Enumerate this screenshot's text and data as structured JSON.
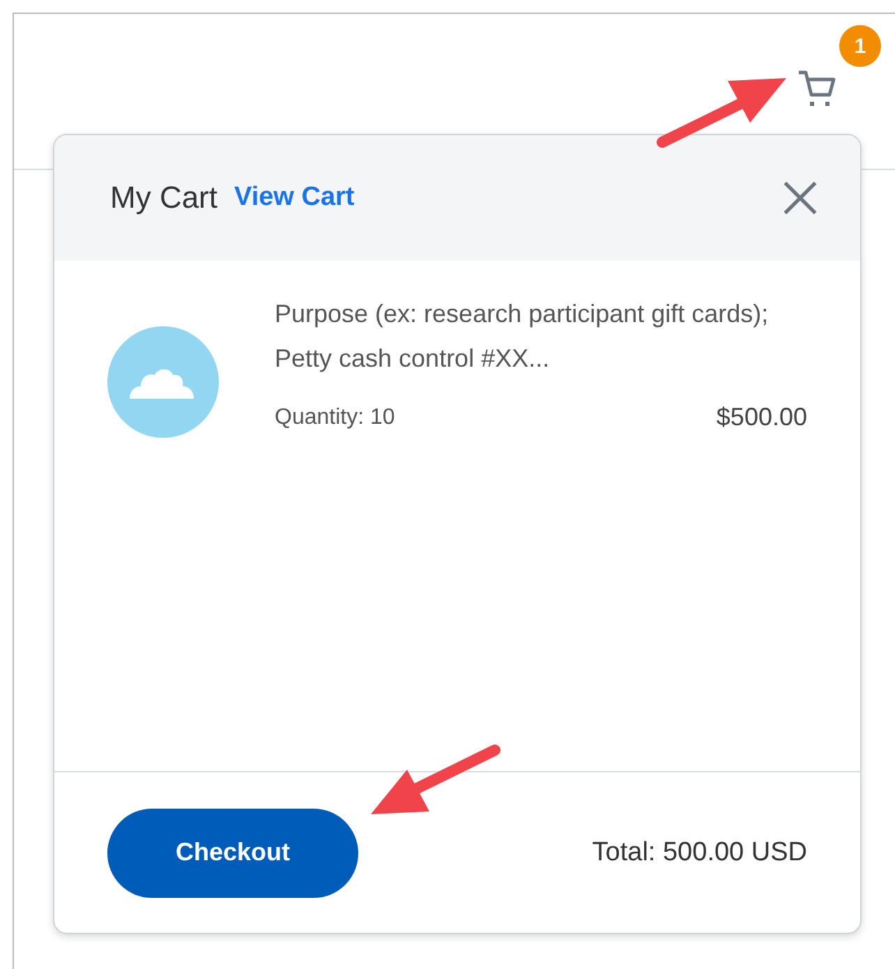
{
  "header": {
    "cart_badge": "1"
  },
  "cart_popup": {
    "title": "My Cart",
    "view_link": "View Cart",
    "items": [
      {
        "description": "Purpose (ex: research participant gift cards); Petty cash control #XX...",
        "quantity": "Quantity: 10",
        "price": "$500.00"
      }
    ],
    "checkout_button": "Checkout",
    "total": "Total: 500.00 USD"
  }
}
